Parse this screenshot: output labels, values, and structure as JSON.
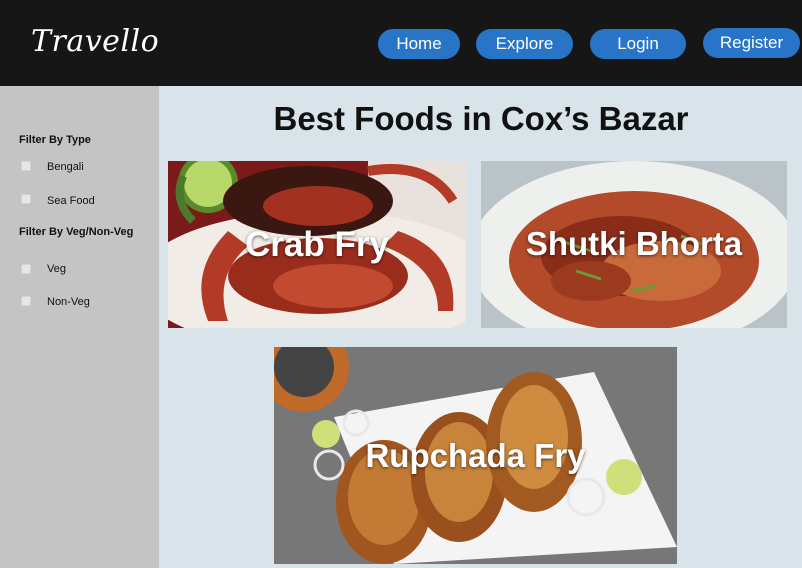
{
  "header": {
    "logo": "Travello",
    "nav": {
      "home": "Home",
      "explore": "Explore",
      "login": "Login",
      "register": "Register"
    }
  },
  "sidebar": {
    "type_heading": "Filter By Type",
    "type_options": [
      "Bengali",
      "Sea Food"
    ],
    "veg_heading": "Filter By Veg/Non-Veg",
    "veg_options": [
      "Veg",
      "Non-Veg"
    ]
  },
  "main": {
    "title": "Best Foods in Cox’s Bazar",
    "foods": [
      "Crab Fry",
      "Shutki Bhorta",
      "Rupchada Fry"
    ]
  },
  "colors": {
    "navbar": "#161616",
    "nav_button": "#2874c6",
    "sidebar": "#c4c4c4",
    "content_bg": "#d9e3ea"
  }
}
